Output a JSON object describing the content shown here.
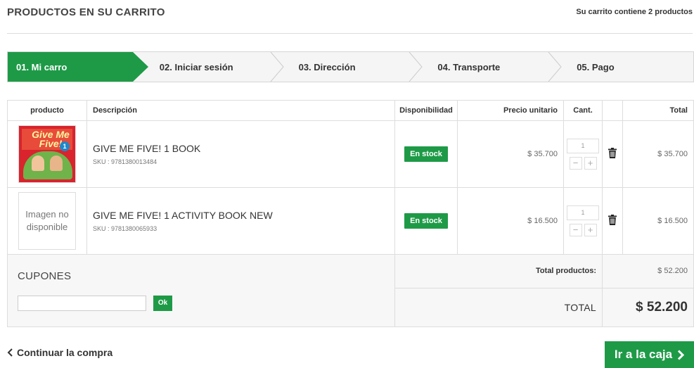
{
  "header": {
    "title": "PRODUCTOS EN SU CARRITO",
    "cart_count": "Su carrito contiene 2 productos"
  },
  "steps": [
    {
      "label": "01. Mi carro",
      "active": true
    },
    {
      "label": "02. Iniciar sesión",
      "active": false
    },
    {
      "label": "03. Dirección",
      "active": false
    },
    {
      "label": "04. Transporte",
      "active": false
    },
    {
      "label": "05. Pago",
      "active": false
    }
  ],
  "table": {
    "columns": [
      "producto",
      "Descripción",
      "Disponibilidad",
      "Precio unitario",
      "Cant.",
      "",
      "Total"
    ],
    "items": [
      {
        "image": "GIVE ME FIVE! book cover",
        "name": "GIVE ME FIVE! 1 BOOK",
        "sku": "SKU : 9781380013484",
        "availability": "En stock",
        "unit_price": "$ 35.700",
        "quantity": "1",
        "total": "$ 35.700"
      },
      {
        "image": "Imagen no disponible",
        "name": "GIVE ME FIVE! 1 ACTIVITY BOOK NEW",
        "sku": "SKU : 9781380065933",
        "availability": "En stock",
        "unit_price": "$ 16.500",
        "quantity": "1",
        "total": "$ 16.500"
      }
    ]
  },
  "coupons": {
    "title": "CUPONES",
    "input_value": "",
    "ok_label": "Ok"
  },
  "summary": {
    "products_label": "Total productos:",
    "products_value": "$ 52.200",
    "total_label": "TOTAL",
    "total_value": "$ 52.200"
  },
  "footer": {
    "continue_label": "Continuar la compra",
    "checkout_label": "Ir a la caja"
  },
  "book_cover_text": {
    "title": "Give Me Five!",
    "badge": "1"
  },
  "colors": {
    "accent": "#1e9a47",
    "border": "#dddddd",
    "summary_bg": "#f7f7f7"
  }
}
